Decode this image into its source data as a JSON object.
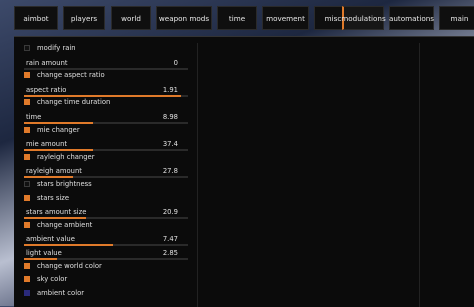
{
  "tabs": [
    {
      "label": "aimbot",
      "active": false
    },
    {
      "label": "players",
      "active": false
    },
    {
      "label": "world",
      "active": false
    },
    {
      "label": "weapon mods",
      "active": false
    },
    {
      "label": "time",
      "active": false
    },
    {
      "label": "movement",
      "active": false
    },
    {
      "label": "misc",
      "active": false
    },
    {
      "label": "modulations",
      "active": true
    },
    {
      "label": "automations",
      "active": false
    },
    {
      "label": "main",
      "active": false
    }
  ],
  "settings": [
    {
      "type": "checkbox",
      "label": "modify rain",
      "checked": false
    },
    {
      "type": "slider",
      "label": "rain amount",
      "value": "0",
      "fraction": 0.0
    },
    {
      "type": "checkbox",
      "label": "change aspect ratio",
      "checked": true
    },
    {
      "type": "slider",
      "label": "aspect ratio",
      "value": "1.91",
      "fraction": 0.96
    },
    {
      "type": "checkbox",
      "label": "change time duration",
      "checked": true
    },
    {
      "type": "slider",
      "label": "time",
      "value": "8.98",
      "fraction": 0.42
    },
    {
      "type": "checkbox",
      "label": "mie changer",
      "checked": true
    },
    {
      "type": "slider",
      "label": "mie amount",
      "value": "37.4",
      "fraction": 0.42
    },
    {
      "type": "checkbox",
      "label": "rayleigh changer",
      "checked": true
    },
    {
      "type": "slider",
      "label": "rayleigh amount",
      "value": "27.8",
      "fraction": 0.3
    },
    {
      "type": "checkbox",
      "label": "stars brightness",
      "checked": false
    },
    {
      "type": "checkbox",
      "label": "stars size",
      "checked": true
    },
    {
      "type": "slider",
      "label": "stars amount size",
      "value": "20.9",
      "fraction": 0.38
    },
    {
      "type": "checkbox",
      "label": "change ambient",
      "checked": true
    },
    {
      "type": "slider",
      "label": "ambient value",
      "value": "7.47",
      "fraction": 0.54
    },
    {
      "type": "slider",
      "label": "light value",
      "value": "2.85",
      "fraction": 0.2
    },
    {
      "type": "checkbox",
      "label": "change world color",
      "checked": true
    },
    {
      "type": "checkbox",
      "label": "sky color",
      "checked": true,
      "color": "#e07a2a"
    },
    {
      "type": "checkbox",
      "label": "ambient color",
      "checked": true,
      "color": "#2a2a7a"
    }
  ],
  "colors": {
    "accent": "#e07a2a",
    "panel": "#0b0b0b",
    "tab": "#0f0f0f"
  }
}
